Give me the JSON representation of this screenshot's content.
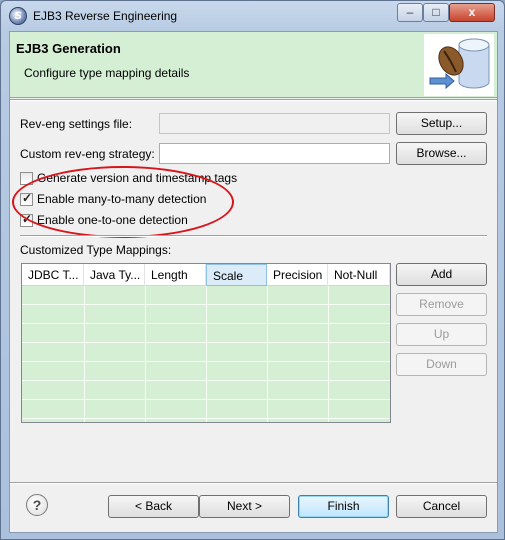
{
  "window": {
    "title": "EJB3 Reverse Engineering",
    "icon": "s-app-icon",
    "min": "–",
    "max": "□",
    "close": "x"
  },
  "header": {
    "title": "EJB3 Generation",
    "description": "Configure type mapping details",
    "image": "coffee-bean-database-icon"
  },
  "form": {
    "settings_label": "Rev-eng settings file:",
    "settings_value": "",
    "setup_button": "Setup...",
    "strategy_label": "Custom rev-eng strategy:",
    "strategy_value": "",
    "browse_button": "Browse..."
  },
  "options": [
    {
      "label": "Generate version and timestamp tags",
      "checked": false
    },
    {
      "label": "Enable many-to-many detection",
      "checked": true
    },
    {
      "label": "Enable one-to-one detection",
      "checked": true
    }
  ],
  "mappings": {
    "label": "Customized Type Mappings:",
    "columns": [
      "JDBC T...",
      "Java Ty...",
      "Length",
      "Scale",
      "Precision",
      "Not-Null"
    ],
    "active_column": "Scale",
    "rows": []
  },
  "side_buttons": {
    "add": {
      "label": "Add",
      "enabled": true
    },
    "remove": {
      "label": "Remove",
      "enabled": false
    },
    "up": {
      "label": "Up",
      "enabled": false
    },
    "down": {
      "label": "Down",
      "enabled": false
    }
  },
  "footer": {
    "help_icon": "help-icon",
    "help_glyph": "?",
    "back": "< Back",
    "next": "Next >",
    "finish": "Finish",
    "cancel": "Cancel"
  },
  "colors": {
    "header_bg": "#d5efd4",
    "highlight_ellipse": "#d8151b",
    "table_bg": "#d5efd4"
  }
}
